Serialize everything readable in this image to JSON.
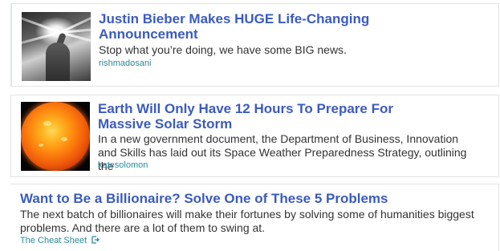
{
  "feed": {
    "items": [
      {
        "title": "Justin Bieber Makes HUGE Life-Changing Announcement",
        "description": "Stop what you’re doing, we have some BIG news.",
        "source": "rishmadosani",
        "thumbnail": "bieber-photo"
      },
      {
        "title": "Earth Will Only Have 12 Hours To Prepare For Massive Solar Storm",
        "description": "In a new government document, the Department of Business, Innovation and Skills has laid out its Space Weather Preparedness Strategy, outlining the",
        "source": "katesolomon",
        "thumbnail": "sun-photo"
      },
      {
        "title": "Want to Be a Billionaire? Solve One of These 5 Problems",
        "description": "The next batch of billionaires will make their fortunes by solving some of humanities biggest problems. And there are a lot of them to swing at.",
        "source": "The Cheat Sheet",
        "source_icon": "external-link-icon"
      }
    ]
  },
  "colors": {
    "title": "#3b5bbd",
    "source": "#2a8a9a",
    "text": "#333333"
  }
}
